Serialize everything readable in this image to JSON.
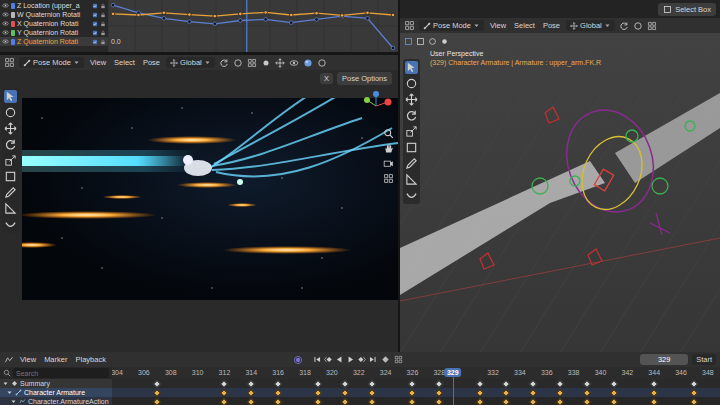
{
  "graph_editor": {
    "channels": [
      {
        "label": "Z Location (upper_a",
        "selected": false,
        "color": "#4f7fe0"
      },
      {
        "label": "W Quaternion Rotati",
        "selected": false,
        "color": "#b8b8b8"
      },
      {
        "label": "X Quaternion Rotati",
        "selected": false,
        "color": "#e0504f"
      },
      {
        "label": "Y Quaternion Rotati",
        "selected": false,
        "color": "#5fc05f"
      },
      {
        "label": "Z Quaternion Rotati",
        "selected": true,
        "color": "#4f7fe0"
      }
    ],
    "value_label": "0.0",
    "series": [
      {
        "color": "#5b7fd0",
        "values": [
          0.95,
          0.6,
          0.35,
          0.2,
          0.1,
          0.25,
          0.3,
          0.15,
          0.3,
          0.45,
          0.35,
          -1.0
        ]
      },
      {
        "color": "#e8a23a",
        "values": [
          0.55,
          0.5,
          0.6,
          0.52,
          0.45,
          0.55,
          0.62,
          0.5,
          0.58,
          0.48,
          0.6,
          0.5
        ]
      }
    ]
  },
  "tool_settings": {
    "select_button": "Select Box"
  },
  "camera_view": {
    "mode": "Pose Mode",
    "menus": [
      "View",
      "Select",
      "Pose"
    ],
    "orientation": "Global",
    "mirror_x": "X",
    "pose_options": "Pose Options"
  },
  "viewport": {
    "mode": "Pose Mode",
    "menus": [
      "View",
      "Select",
      "Pose"
    ],
    "orientation": "Global",
    "perspective": "User Perspective",
    "object_info": "(329) Character Armature | Armature : upper_arm.FK.R"
  },
  "timeline": {
    "menus": [
      "View",
      "Marker",
      "Playback"
    ],
    "current_frame": "329",
    "start_label": "Start",
    "search": {
      "placeholder": "Search"
    },
    "ruler": [
      "304",
      "306",
      "308",
      "310",
      "312",
      "314",
      "316",
      "318",
      "320",
      "322",
      "324",
      "326",
      "328",
      "332",
      "334",
      "336",
      "338",
      "340",
      "342",
      "344",
      "346",
      "348"
    ],
    "channels": [
      {
        "label": "Summary",
        "selected": false,
        "expanded": true,
        "keys": [
          307,
          312,
          314,
          316,
          319,
          321,
          323,
          326,
          328,
          331,
          333,
          335,
          337,
          339,
          341,
          344,
          347
        ]
      },
      {
        "label": "Character Armature",
        "selected": true,
        "expanded": true,
        "keys": [
          307,
          312,
          314,
          316,
          319,
          321,
          323,
          326,
          328,
          331,
          333,
          335,
          337,
          339,
          341,
          344,
          347
        ]
      },
      {
        "label": "Character.ArmatureAction",
        "selected": false,
        "expanded": true,
        "keys": [
          307,
          312,
          314,
          316,
          319,
          321,
          323,
          326,
          328,
          331,
          333,
          335,
          337,
          339,
          341,
          344,
          347
        ]
      }
    ]
  }
}
